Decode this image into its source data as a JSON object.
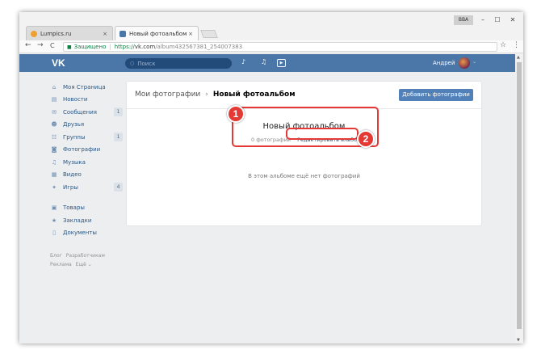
{
  "browser": {
    "tabs": [
      {
        "title": "Lumpics.ru",
        "favicon_color": "#f0a030"
      },
      {
        "title": "Новый фотоальбом",
        "favicon_color": "#4a76a8"
      }
    ],
    "close_glyph": "×",
    "window_controls": [
      "–",
      "☐",
      "✕"
    ],
    "user_label": "BBA",
    "nav": {
      "back": "←",
      "forward": "→",
      "reload": "C"
    },
    "security_label": "Защищено",
    "url_protocol": "https://",
    "url_host": "vk.com",
    "url_path": "/album432567381_254007383",
    "bookmark_glyph": "☆",
    "menu_glyph": "⋮"
  },
  "vk_header": {
    "logo": "VK",
    "search_placeholder": "Поиск",
    "user_name": "Андрей",
    "colors": {
      "header_bg": "#4a76a8",
      "button_bg": "#5181b8",
      "link": "#2a5885"
    }
  },
  "sidebar": {
    "items": [
      {
        "label": "Моя Страница",
        "icon": "home-icon",
        "glyph": "⌂",
        "badge": ""
      },
      {
        "label": "Новости",
        "icon": "news-icon",
        "glyph": "▤",
        "badge": ""
      },
      {
        "label": "Сообщения",
        "icon": "messages-icon",
        "glyph": "✉",
        "badge": "1"
      },
      {
        "label": "Друзья",
        "icon": "friends-icon",
        "glyph": "☻",
        "badge": ""
      },
      {
        "label": "Группы",
        "icon": "groups-icon",
        "glyph": "☷",
        "badge": "1"
      },
      {
        "label": "Фотографии",
        "icon": "photos-icon",
        "glyph": "◙",
        "badge": ""
      },
      {
        "label": "Музыка",
        "icon": "music-icon",
        "glyph": "♫",
        "badge": ""
      },
      {
        "label": "Видео",
        "icon": "video-icon",
        "glyph": "▦",
        "badge": ""
      },
      {
        "label": "Игры",
        "icon": "games-icon",
        "glyph": "✦",
        "badge": "4"
      }
    ],
    "secondary": [
      {
        "label": "Товары",
        "icon": "goods-icon",
        "glyph": "▣"
      },
      {
        "label": "Закладки",
        "icon": "bookmarks-icon",
        "glyph": "★"
      },
      {
        "label": "Документы",
        "icon": "documents-icon",
        "glyph": "▯"
      }
    ],
    "footer": [
      "Блог",
      "Разработчикам",
      "Реклама",
      "Ещё ⌄"
    ]
  },
  "album": {
    "breadcrumb_root": "Мои фотографии",
    "breadcrumb_current": "Новый фотоальбом",
    "add_photos_label": "Добавить фотографии",
    "title": "Новый фотоальбом",
    "photo_count": "0 фотографий",
    "separator": "·",
    "edit_label": "Редактировать альбом",
    "empty_text": "В этом альбоме ещё нет фотографий"
  },
  "annotations": {
    "marker1": "1",
    "marker2": "2",
    "color": "#e53935"
  }
}
